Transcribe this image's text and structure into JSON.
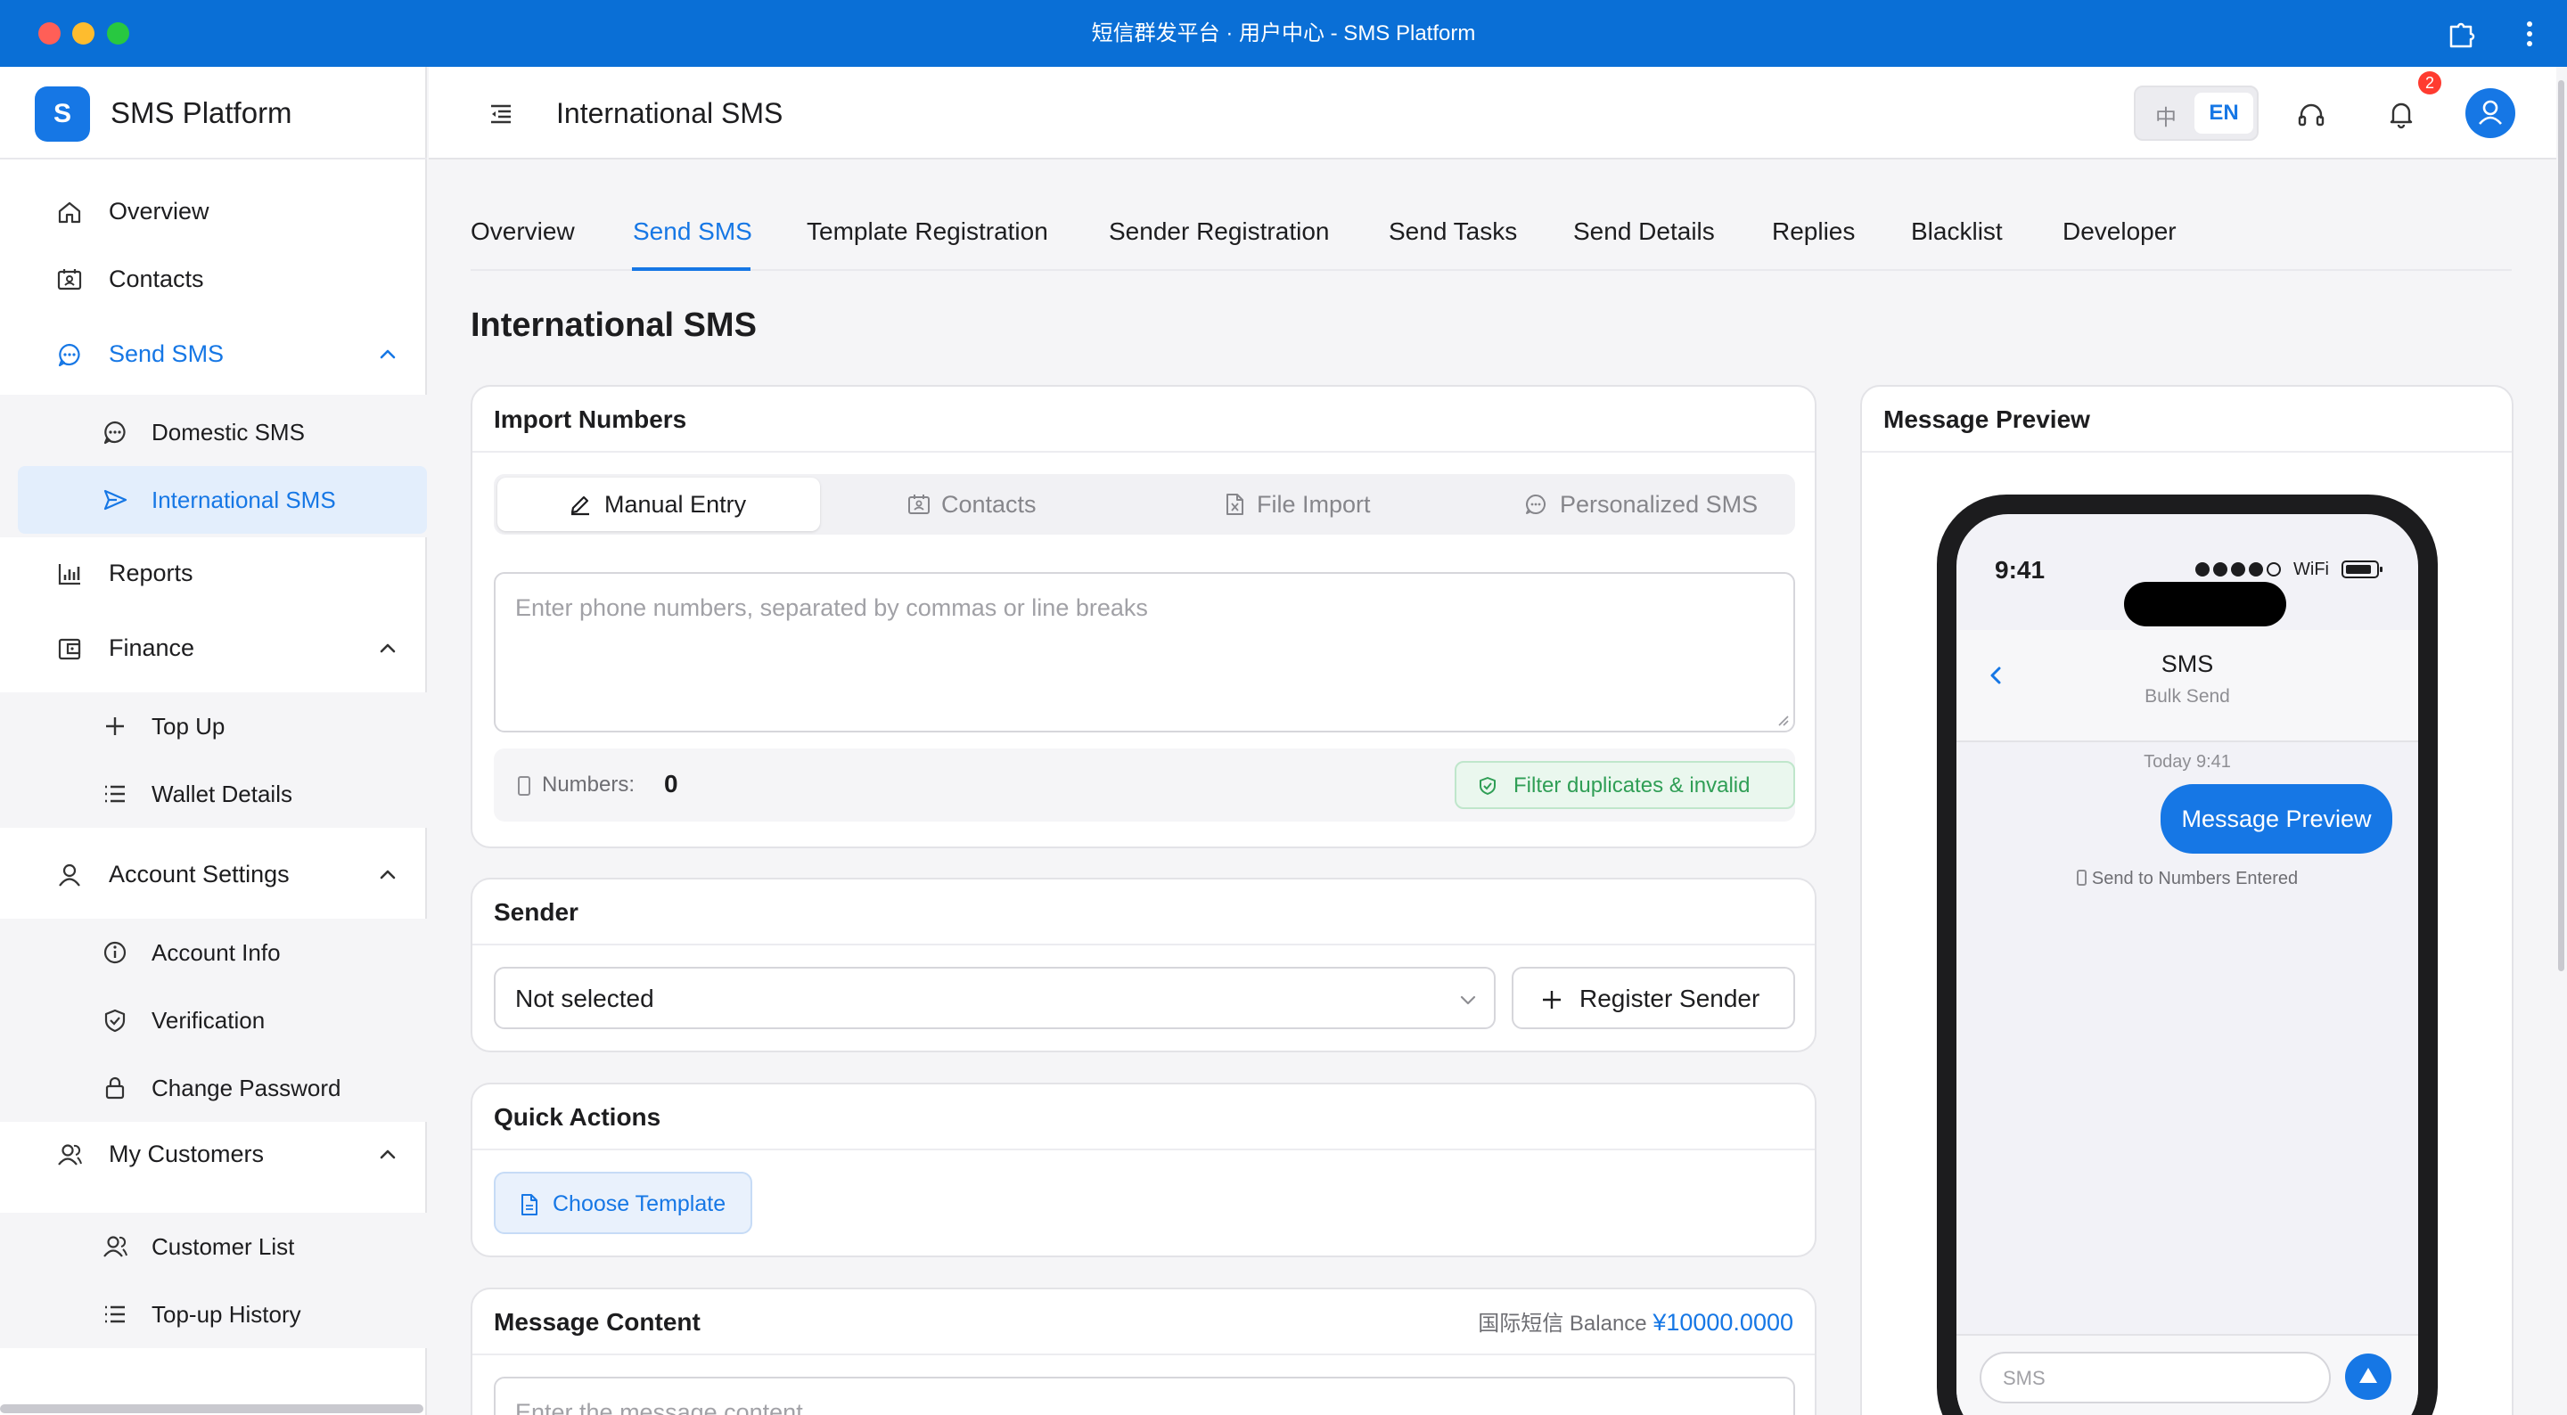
{
  "window": {
    "title": "短信群发平台 · 用户中心 - SMS Platform"
  },
  "brand": {
    "logo_letter": "S",
    "name": "SMS Platform",
    "accent": "#1677e5"
  },
  "sidebar": {
    "items": [
      {
        "label": "Overview",
        "icon": "home-icon"
      },
      {
        "label": "Contacts",
        "icon": "contacts-icon"
      },
      {
        "label": "Send SMS",
        "icon": "chat-icon",
        "active": true,
        "expanded": true,
        "children": [
          {
            "label": "Domestic SMS",
            "icon": "chat-icon"
          },
          {
            "label": "International SMS",
            "icon": "send-icon",
            "active": true
          }
        ]
      },
      {
        "label": "Reports",
        "icon": "bar-chart-icon"
      },
      {
        "label": "Finance",
        "icon": "wallet-icon",
        "expanded": true,
        "children": [
          {
            "label": "Top Up",
            "icon": "plus-icon"
          },
          {
            "label": "Wallet Details",
            "icon": "list-icon"
          }
        ]
      },
      {
        "label": "Account Settings",
        "icon": "user-icon",
        "expanded": true,
        "children": [
          {
            "label": "Account Info",
            "icon": "info-icon"
          },
          {
            "label": "Verification",
            "icon": "shield-icon"
          },
          {
            "label": "Change Password",
            "icon": "lock-icon"
          }
        ]
      },
      {
        "label": "My Customers",
        "icon": "customers-icon",
        "expanded": true,
        "children": [
          {
            "label": "Customer List",
            "icon": "customers-icon"
          },
          {
            "label": "Top-up History",
            "icon": "list-icon"
          }
        ]
      }
    ]
  },
  "header": {
    "title": "International SMS",
    "lang_zh": "中",
    "lang_en": "EN",
    "notifications_count": "2"
  },
  "tabs": [
    {
      "label": "Overview"
    },
    {
      "label": "Send SMS",
      "active": true
    },
    {
      "label": "Template Registration"
    },
    {
      "label": "Sender Registration"
    },
    {
      "label": "Send Tasks"
    },
    {
      "label": "Send Details"
    },
    {
      "label": "Replies"
    },
    {
      "label": "Blacklist"
    },
    {
      "label": "Developer"
    }
  ],
  "page": {
    "title": "International SMS"
  },
  "import_numbers": {
    "title": "Import Numbers",
    "modes": [
      {
        "label": "Manual Entry",
        "icon": "pencil-icon",
        "active": true
      },
      {
        "label": "Contacts",
        "icon": "contacts-icon"
      },
      {
        "label": "File Import",
        "icon": "excel-file-icon"
      },
      {
        "label": "Personalized SMS",
        "icon": "chat-icon"
      }
    ],
    "placeholder": "Enter phone numbers, separated by commas or line breaks",
    "count_label": "Numbers:",
    "count_value": "0",
    "filter_label": "Filter duplicates & invalid"
  },
  "sender": {
    "title": "Sender",
    "selected": "Not selected",
    "register_label": "Register Sender"
  },
  "quick_actions": {
    "title": "Quick Actions",
    "choose_template": "Choose Template"
  },
  "message_content": {
    "title": "Message Content",
    "balance_label": "国际短信 Balance",
    "balance_value": "¥10000.0000",
    "placeholder": "Enter the message content"
  },
  "preview": {
    "title": "Message Preview",
    "status_time": "9:41",
    "wifi": "WiFi",
    "contact_name": "SMS",
    "contact_sub": "Bulk Send",
    "timestamp": "Today 9:41",
    "bubble_text": "Message Preview",
    "send_to": "Send to Numbers Entered",
    "compose_placeholder": "SMS"
  },
  "colors": {
    "titlebar": "#0a6fd6",
    "accent": "#1677e5",
    "success": "#2f9e55",
    "badge": "#ff3b30"
  }
}
